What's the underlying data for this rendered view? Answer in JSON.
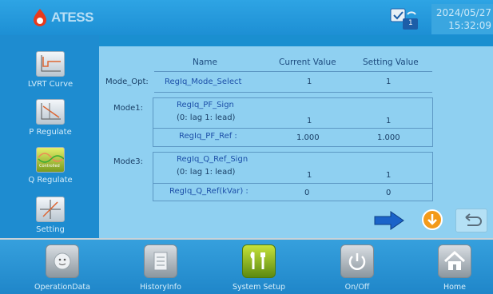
{
  "brand": {
    "logo_text": "ATESS",
    "accent": "#e83a1c"
  },
  "status": {
    "date": "2024/05/27",
    "time": "15:32:09",
    "badge": "1"
  },
  "sidebar": {
    "items": [
      {
        "label": "LVRT Curve",
        "icon": "lvrt-curve-icon"
      },
      {
        "label": "P Regulate",
        "icon": "p-regulate-icon"
      },
      {
        "label": "Q Regulate",
        "icon": "q-regulate-icon",
        "active": true,
        "icon_text": "Controlled"
      },
      {
        "label": "Setting",
        "icon": "setting-icon"
      }
    ]
  },
  "table": {
    "headers": {
      "name": "Name",
      "current": "Current Value",
      "setting": "Setting Value"
    },
    "mode_opt": {
      "label": "Mode_Opt:",
      "name": "RegIq_Mode_Select",
      "current": "1",
      "setting": "1"
    },
    "mode1": {
      "label": "Mode1:",
      "sign_name": "RegIq_PF_Sign",
      "sign_hint": "(0: lag 1: lead)",
      "sign_current": "1",
      "sign_setting": "1",
      "ref_name": "RegIq_PF_Ref :",
      "ref_current": "1.000",
      "ref_setting": "1.000"
    },
    "mode3": {
      "label": "Mode3:",
      "sign_name": "RegIq_Q_Ref_Sign",
      "sign_hint": "(0: lag 1: lead)",
      "sign_current": "1",
      "sign_setting": "1",
      "ref_name": "RegIq_Q_Ref(kVar) :",
      "ref_current": "0",
      "ref_setting": "0"
    }
  },
  "bottom_nav": [
    {
      "label": "OperationData",
      "icon": "operation-data-icon"
    },
    {
      "label": "HistoryInfo",
      "icon": "history-info-icon"
    },
    {
      "label": "System Setup",
      "icon": "system-setup-icon",
      "active": true
    },
    {
      "label": "On/Off",
      "icon": "power-icon"
    },
    {
      "label": "Home",
      "icon": "home-icon"
    }
  ]
}
